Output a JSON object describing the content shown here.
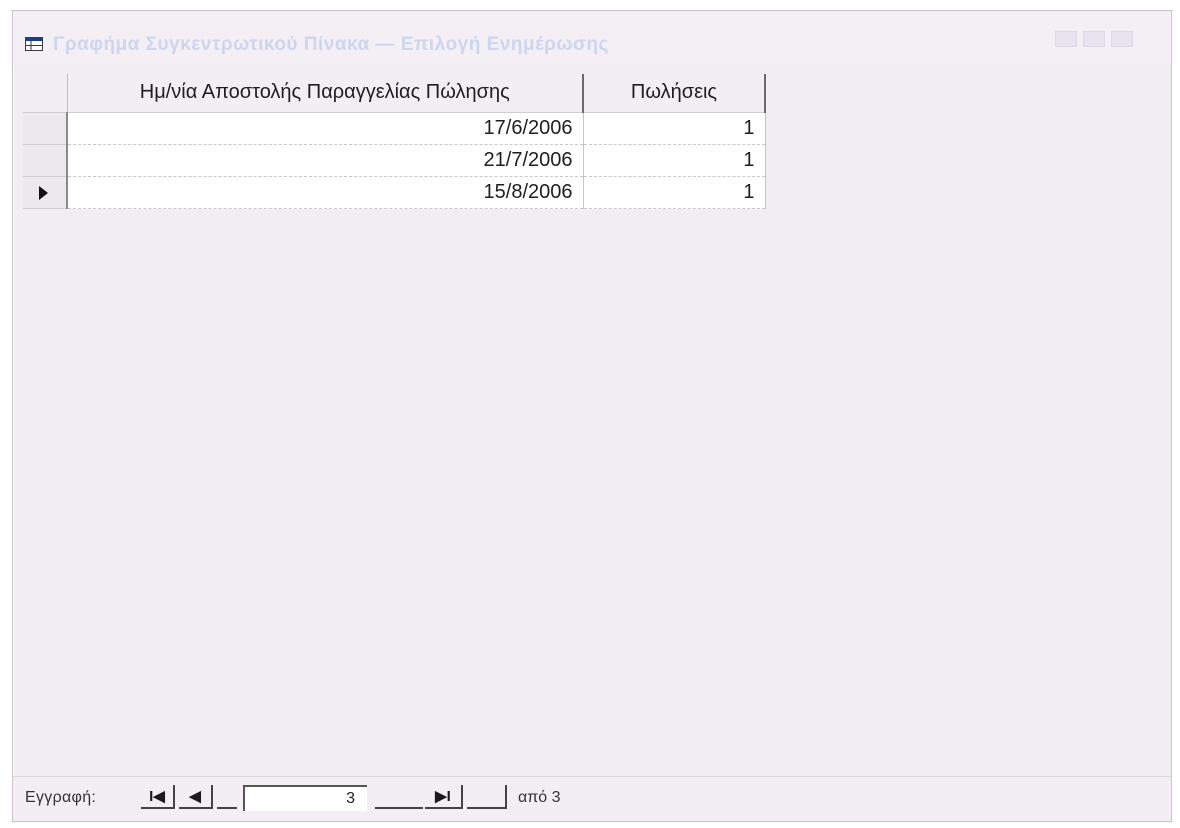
{
  "window": {
    "title": "Γραφήμα Συγκεντρωτικού Πίνακα — Επιλογή Ενημέρωσης",
    "icons": {
      "title": "datasheet-icon"
    }
  },
  "datasheet": {
    "columns": [
      "Ημ/νία Αποστολής Παραγγελίας Πώλησης",
      "Πωλήσεις"
    ],
    "rows": [
      {
        "date": "17/6/2006",
        "sales": "1",
        "current": false
      },
      {
        "date": "21/7/2006",
        "sales": "1",
        "current": false
      },
      {
        "date": "15/8/2006",
        "sales": "1",
        "current": true
      }
    ]
  },
  "navigation": {
    "record_label": "Εγγραφή:",
    "first_symbol": "I◀",
    "prev_symbol": "◀",
    "current_record": "3",
    "last_symbol": "▶I",
    "of_text": "από 3"
  },
  "colors": {
    "window_bg": "#f1eef2",
    "grid_bg": "#ffffff"
  }
}
